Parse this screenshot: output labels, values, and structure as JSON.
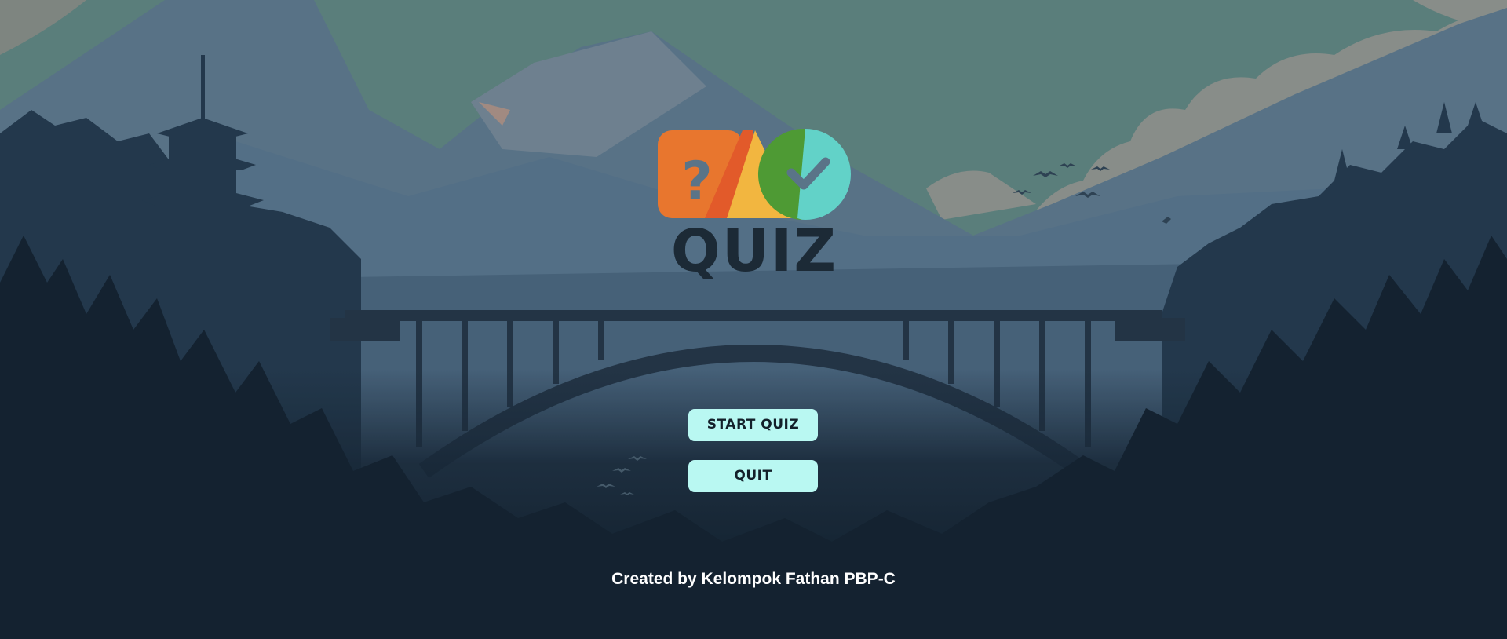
{
  "logo": {
    "question_mark": "?",
    "word": "QUIZ"
  },
  "menu": {
    "start_label": "START QUIZ",
    "quit_label": "QUIT"
  },
  "footer": {
    "credit": "Created by Kelompok Fathan PBP-C"
  },
  "colors": {
    "button_bg": "#b9f8f2",
    "sky": "#6a8d8a",
    "logo_orange": "#e8762e",
    "logo_red": "#e25a2a",
    "logo_yellow": "#f2b640",
    "logo_green": "#4e9a34",
    "logo_teal": "#62d2c8"
  },
  "icons": [
    "question-icon",
    "check-icon"
  ]
}
